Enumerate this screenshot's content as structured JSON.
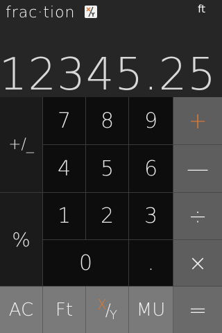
{
  "header": {
    "title": "frac·tion",
    "fraction_icon": "fraction-xy-icon",
    "unit": "ft"
  },
  "display": {
    "value": "12345.25"
  },
  "keys": {
    "plus_minus": "+/_",
    "percent": "%",
    "d7": "7",
    "d8": "8",
    "d9": "9",
    "d4": "4",
    "d5": "5",
    "d6": "6",
    "d1": "1",
    "d2": "2",
    "d3": "3",
    "d0": "0",
    "dot": ".",
    "plus": "+",
    "minus": "—",
    "divide": "÷",
    "multiply": "×",
    "equals": "=",
    "ac": "AC",
    "ft": "Ft",
    "mu": "MU",
    "xy_x": "X",
    "xy_slash": "/",
    "xy_y": "Y"
  },
  "colors": {
    "accent": "#d67a35",
    "header_bg": "#262626",
    "operator_bg": "#5e5e5e",
    "bottom_bg": "#7a7a7a"
  }
}
